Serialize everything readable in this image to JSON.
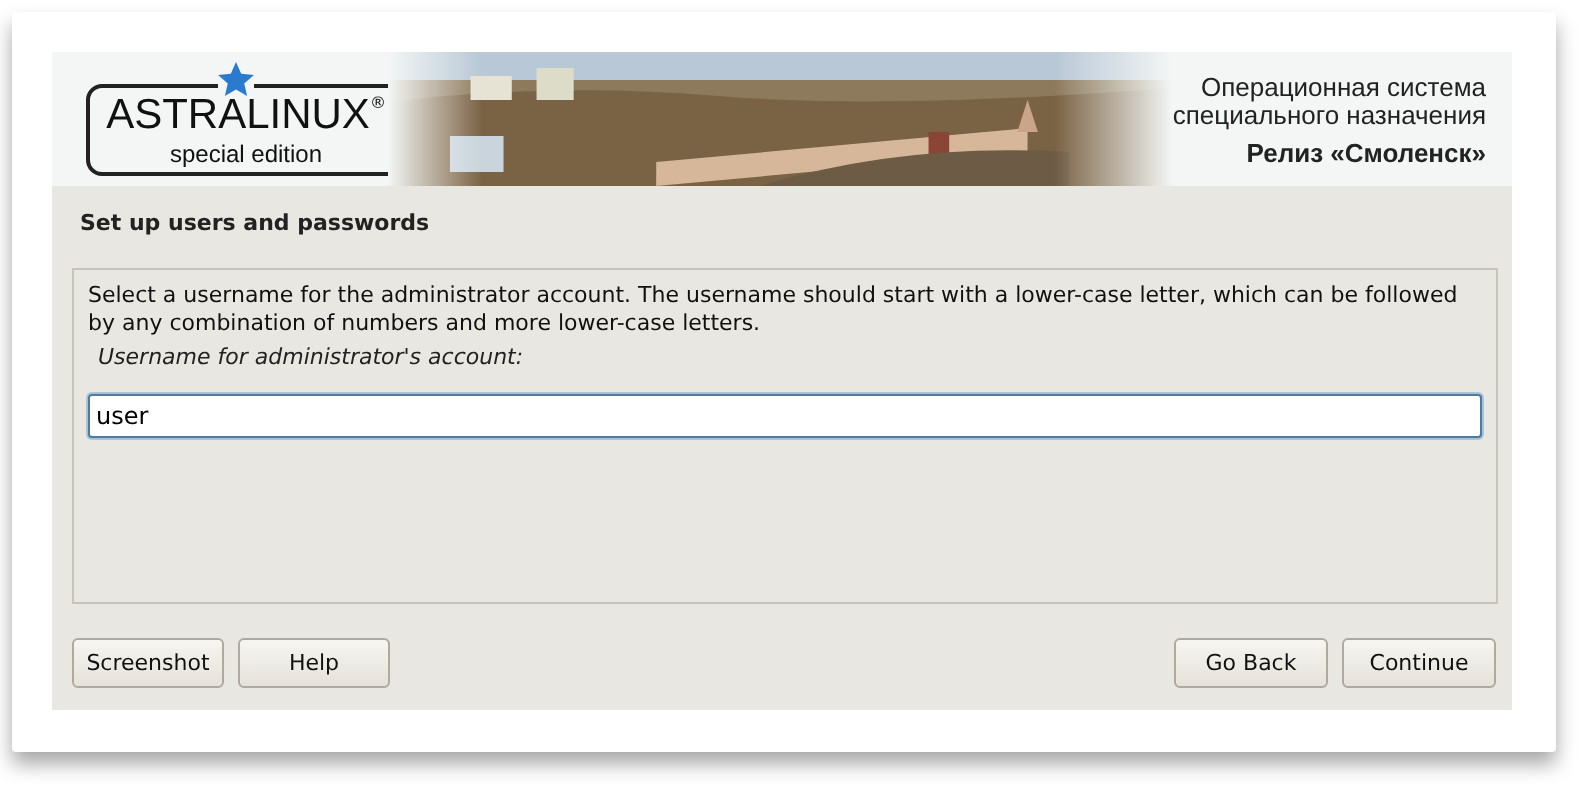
{
  "banner": {
    "logo": {
      "name": "ASTRALINUX",
      "mark": "®",
      "edition": "special edition"
    },
    "kind": "picture",
    "tagline": [
      "Операционная система",
      "специального назначения"
    ],
    "release": "Релиз «Смоленск»"
  },
  "heading": "Set up users and passwords",
  "description": "Select a username for the administrator account. The username should start with a lower-case letter, which can be followed by any combination of numbers and more lower-case letters.",
  "field": {
    "label": "Username for administrator's account:",
    "value": "user"
  },
  "buttons_left": [
    "Screenshot",
    "Help"
  ],
  "buttons_right": [
    "Go Back",
    "Continue"
  ]
}
